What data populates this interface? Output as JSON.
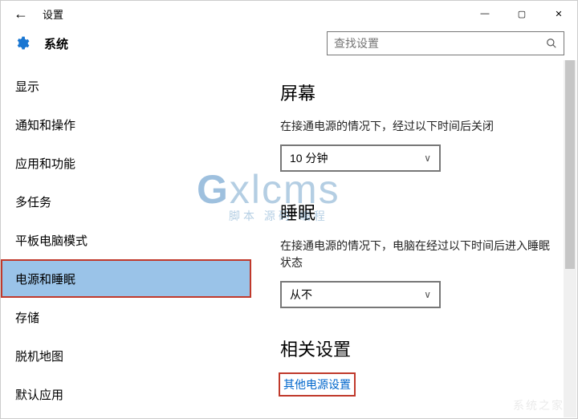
{
  "window": {
    "title": "设置",
    "back_glyph": "←",
    "minimize_glyph": "—",
    "maximize_glyph": "▢",
    "close_glyph": "✕"
  },
  "header": {
    "heading": "系统",
    "search_placeholder": "查找设置"
  },
  "sidebar": {
    "items": [
      {
        "label": "显示",
        "selected": false
      },
      {
        "label": "通知和操作",
        "selected": false
      },
      {
        "label": "应用和功能",
        "selected": false
      },
      {
        "label": "多任务",
        "selected": false
      },
      {
        "label": "平板电脑模式",
        "selected": false
      },
      {
        "label": "电源和睡眠",
        "selected": true
      },
      {
        "label": "存储",
        "selected": false
      },
      {
        "label": "脱机地图",
        "selected": false
      },
      {
        "label": "默认应用",
        "selected": false
      }
    ]
  },
  "main": {
    "screen": {
      "title": "屏幕",
      "desc": "在接通电源的情况下，经过以下时间后关闭",
      "value": "10 分钟"
    },
    "sleep": {
      "title": "睡眠",
      "desc": "在接通电源的情况下，电脑在经过以下时间后进入睡眠状态",
      "value": "从不"
    },
    "related": {
      "title": "相关设置",
      "link": "其他电源设置"
    }
  },
  "watermark": {
    "line1_a": "G",
    "line1_b": "xlcms",
    "line2": "脚本 源码 编程"
  },
  "watermark2": "系统之家"
}
